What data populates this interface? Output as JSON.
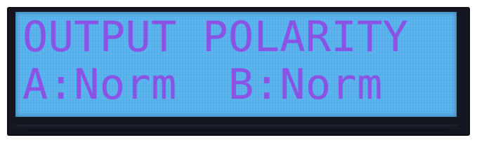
{
  "display": {
    "line1": "OUTPUT POLARITY",
    "line2": "A:Norm  B:Norm"
  },
  "colors": {
    "lcd_background": "#5ab4ee",
    "lcd_text": "#8d53e6",
    "bezel": "#141720"
  }
}
